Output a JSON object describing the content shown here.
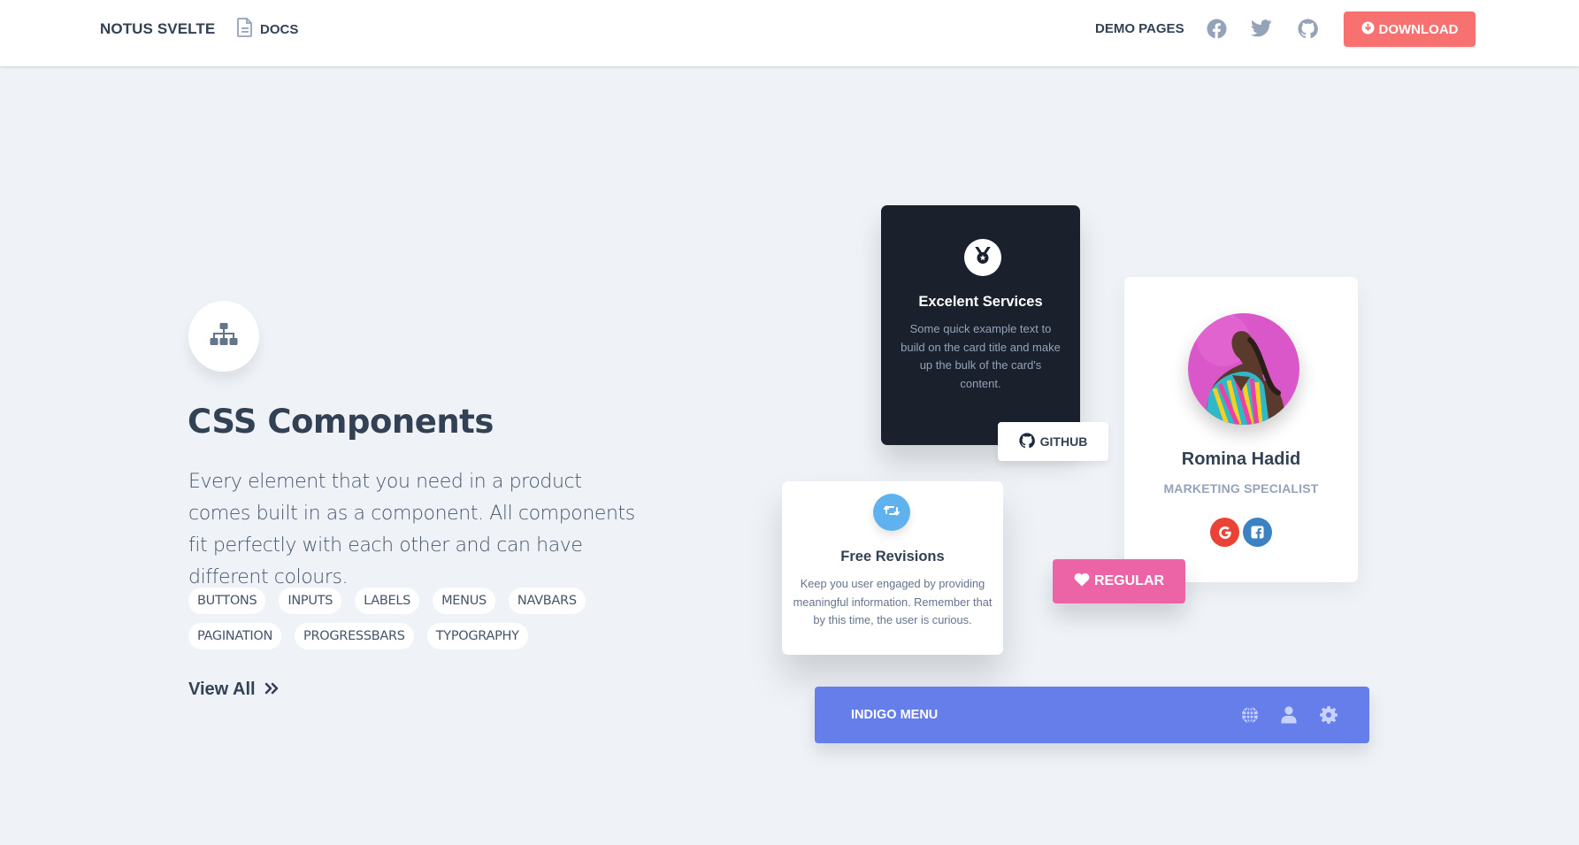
{
  "navbar": {
    "brand": "NOTUS SVELTE",
    "docs_label": "DOCS",
    "docs_icon": "file-text-icon",
    "demo_pages_label": "DEMO PAGES",
    "social_icons": [
      "facebook-icon",
      "twitter-icon",
      "github-icon"
    ],
    "download_label": "DOWNLOAD",
    "download_icon": "arrow-circle-down-icon"
  },
  "hero": {
    "icon": "sitemap-icon",
    "title": "CSS Components",
    "description": "Every element that you need in a product comes built in as a component. All components fit perfectly with each other and can have different colours.",
    "tags": [
      "BUTTONS",
      "INPUTS",
      "LABELS",
      "MENUS",
      "NAVBARS",
      "PAGINATION",
      "PROGRESSBARS",
      "TYPOGRAPHY"
    ],
    "view_all_label": "View All",
    "view_all_icon": "angle-double-right-icon"
  },
  "cards": {
    "excelent": {
      "icon": "medal-icon",
      "title": "Excelent Services",
      "text": "Some quick example text to build on the card title and make up the bulk of the card's content."
    },
    "github_button": {
      "label": "GITHUB",
      "icon": "github-icon"
    },
    "profile": {
      "name": "Romina Hadid",
      "role": "MARKETING SPECIALIST",
      "social": [
        "google-icon",
        "facebook-icon"
      ],
      "colors": {
        "google": "#ea4335",
        "facebook": "#3b82c4"
      }
    },
    "free_revisions": {
      "icon": "retweet-icon",
      "title": "Free Revisions",
      "text": "Keep you user engaged by providing meaningful information. Remember that by this time, the user is curious."
    },
    "regular_button": {
      "label": "REGULAR",
      "icon": "heart-icon"
    },
    "indigo_menu": {
      "label": "INDIGO MENU",
      "icons": [
        "globe-icon",
        "user-icon",
        "gear-icon"
      ]
    }
  },
  "colors": {
    "background": "#eff3f8",
    "download": "#f87171",
    "dark_card": "#1a202c",
    "regular": "#ec64a6",
    "indigo": "#667eea",
    "light_blue": "#60b2ef"
  }
}
